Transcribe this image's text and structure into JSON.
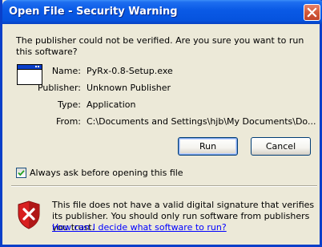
{
  "window": {
    "title": "Open File - Security Warning"
  },
  "question": "The publisher could not be verified.  Are you sure you want to run this software?",
  "details": [
    {
      "label": "Name:",
      "value": "PyRx-0.8-Setup.exe"
    },
    {
      "label": "Publisher:",
      "value": "Unknown Publisher"
    },
    {
      "label": "Type:",
      "value": "Application"
    },
    {
      "label": "From:",
      "value": "C:\\Documents and Settings\\hjb\\My Documents\\Do..."
    }
  ],
  "buttons": {
    "run": "Run",
    "cancel": "Cancel"
  },
  "checkbox": {
    "label": "Always ask before opening this file",
    "checked": true
  },
  "warning": {
    "text": "This file does not have a valid digital signature that verifies its publisher.  You should only run software from publishers you trust.",
    "link": "How can I decide what software to run?"
  },
  "colors": {
    "title_bar": "#0a5ae6",
    "dialog_bg": "#ece9d8",
    "link": "#0000ff",
    "shield_red": "#cc2020"
  },
  "icons": [
    "close-icon",
    "application-window-icon",
    "security-shield-icon",
    "checkmark-icon"
  ]
}
